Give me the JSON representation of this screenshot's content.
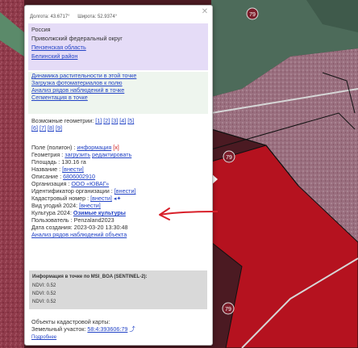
{
  "coords": {
    "longitude": "Долгота: 43.6717°",
    "latitude": "Широта: 52.9374°"
  },
  "region": {
    "country": "Россия",
    "district": "Приволжский федеральный округ",
    "oblast_link": "Пензенская область",
    "raion_link": "Белинский район"
  },
  "actions": [
    "Динамика растительности в этой точке",
    "Загрузка фотоматериалов к полю",
    "Анализ рядов наблюдений в точке",
    "Сегментация в точке"
  ],
  "geometries": {
    "label": "Возможные геометрии:",
    "row1": [
      "[1]",
      "[2]",
      "[3]",
      "[4]",
      "[5]"
    ],
    "row2": [
      "[6]",
      "[7]",
      "[8]",
      "[9]"
    ]
  },
  "field": {
    "polygon_label": "Поле (полигон) :",
    "polygon_info_link": "информация",
    "polygon_delete": "[x]",
    "geometry_label": "Геометрия :",
    "geometry_load_link": "загрузить",
    "geometry_edit_link": "редактировать",
    "area_label": "Площадь : 130.16 га",
    "name_label": "Название :",
    "name_link": "[внести]",
    "description_label": "Описание :",
    "description_link": "6806002910",
    "org_label": "Организация :",
    "org_link": "ООО «ЮВАГ»",
    "org_id_label": "Идентификатор организации :",
    "org_id_link": "[внести]",
    "cadastral_label": "Кадастровый номер :",
    "cadastral_link": "[внести]",
    "land_type_label": "Вид угодий 2024:",
    "land_type_link": "[внести]",
    "culture_label": "Культура 2024:",
    "culture_link": "Озимые культуры",
    "user_label": "Пользователь : Penzaland2023",
    "created_label": "Дата создания: 2023-03-20 13:30:48",
    "analysis_link": "Анализ рядов наблюдений объекта"
  },
  "point_info": {
    "title": "Информация в точке по MSI_BOA (SENTINEL-2):",
    "rows": [
      "NDVI: 0.52",
      "NDVI: 0.52",
      "NDVI: 0.52"
    ]
  },
  "cadastre": {
    "title": "Объекты кадастровой карты:",
    "parcel_label": "Земельный участок:",
    "parcel_number": "58:4:393606:79",
    "details_link": "Подробнее"
  },
  "map_labels": {
    "road_top": "79",
    "road_mid": "79",
    "road_bottom": "79"
  },
  "colors": {
    "link": "#2344c6",
    "region_bg": "#e5dcf7",
    "annotation_arrow": "#d8202a",
    "field_red": "#b5121f"
  },
  "icons": {
    "close": "close-icon",
    "cadastral_pointer": "pointer-icon",
    "parcel_open": "external-link-icon"
  }
}
